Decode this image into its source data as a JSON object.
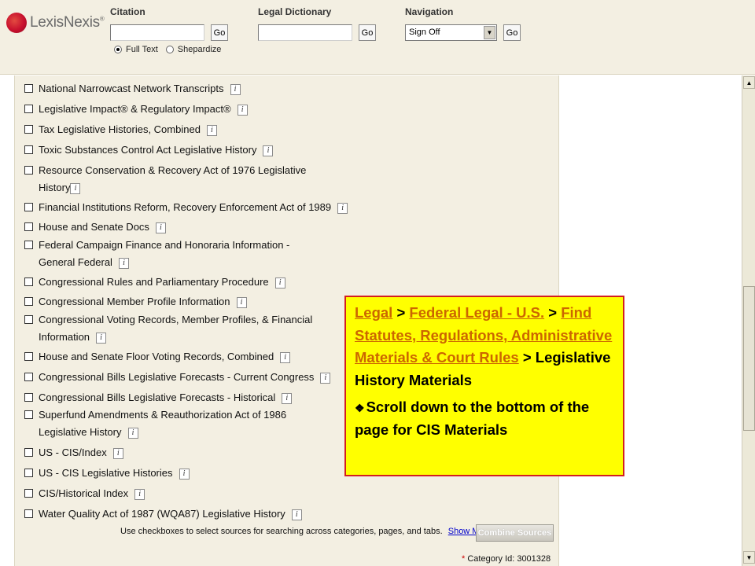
{
  "header": {
    "logo_text": "LexisNexis",
    "logo_mark": "®",
    "citation_label": "Citation",
    "citation_value": "",
    "go_label": "Go",
    "dictionary_label": "Legal Dictionary",
    "dictionary_value": "",
    "navigation_label": "Navigation",
    "navigation_selected": "Sign Off",
    "radio_full_text": "Full Text",
    "radio_shepardize": "Shepardize"
  },
  "sources": [
    {
      "label": "National Narrowcast Network Transcripts"
    },
    {
      "label": "Legislative Impact® & Regulatory Impact®"
    },
    {
      "label": "Tax Legislative Histories, Combined"
    },
    {
      "label": "Toxic Substances Control Act Legislative History"
    },
    {
      "label": "Resource Conservation & Recovery Act of 1976 Legislative History"
    },
    {
      "label": "Financial Institutions Reform, Recovery Enforcement Act of 1989"
    },
    {
      "label": "House and Senate Docs"
    },
    {
      "label": "Federal Campaign Finance and Honoraria Information - General Federal"
    },
    {
      "label": "Congressional Rules and Parliamentary Procedure"
    },
    {
      "label": "Congressional Member Profile Information"
    },
    {
      "label": "Congressional Voting Records, Member Profiles, & Financial Information"
    },
    {
      "label": "House and Senate Floor Voting Records, Combined"
    },
    {
      "label": "Congressional Bills Legislative Forecasts - Current Congress"
    },
    {
      "label": "Congressional Bills Legislative Forecasts - Historical"
    },
    {
      "label": "Superfund Amendments & Reauthorization Act of 1986 Legislative History"
    },
    {
      "label": "US - CIS/Index"
    },
    {
      "label": "US - CIS Legislative Histories"
    },
    {
      "label": "CIS/Historical Index"
    },
    {
      "label": "Water Quality Act of 1987 (WQA87) Legislative History"
    }
  ],
  "info_glyph": "i",
  "footer": {
    "note": "Use checkboxes to select sources for searching across categories, pages, and tabs.",
    "show_me": "Show Me...",
    "combine_button": "Combine Sources",
    "category_star": "*",
    "category_id": "Category Id: 3001328"
  },
  "callout": {
    "crumb_legal": "Legal",
    "sep": ">",
    "crumb_federal": "Federal Legal - U.S.",
    "crumb_statutes": "Find Statutes, Regulations, Administrative Materials & Court Rules",
    "crumb_current": "Legislative History Materials",
    "note": "Scroll down to the bottom of the page for CIS Materials"
  },
  "colors": {
    "panel_bg": "#f3efe2",
    "callout_bg": "#ffff00",
    "callout_border": "#d21f1f",
    "link_orange": "#cc6600"
  }
}
